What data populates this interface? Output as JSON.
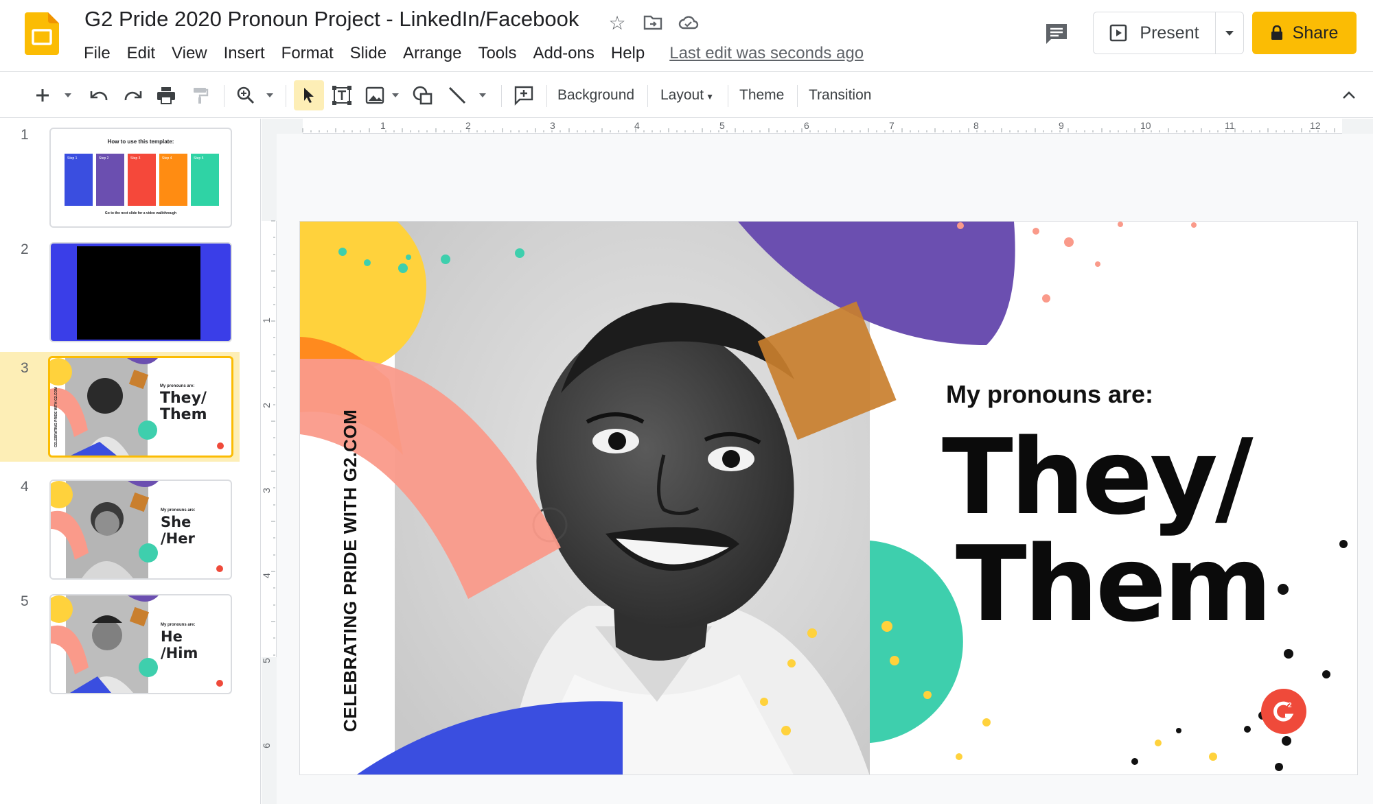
{
  "app": {
    "title": "G2 Pride 2020 Pronoun Project - LinkedIn/Facebook",
    "menu": [
      "File",
      "Edit",
      "View",
      "Insert",
      "Format",
      "Slide",
      "Arrange",
      "Tools",
      "Add-ons",
      "Help"
    ],
    "last_edit": "Last edit was seconds ago",
    "present_label": "Present",
    "share_label": "Share"
  },
  "toolbar": {
    "background_label": "Background",
    "layout_label": "Layout",
    "theme_label": "Theme",
    "transition_label": "Transition"
  },
  "ruler": {
    "horizontal": [
      "1",
      "2",
      "3",
      "4",
      "5",
      "6",
      "7",
      "8",
      "9",
      "10",
      "11",
      "12"
    ],
    "vertical": [
      "1",
      "2",
      "3",
      "4",
      "5",
      "6"
    ]
  },
  "filmstrip": {
    "active_index": 3,
    "slides": [
      {
        "number": "1",
        "title": "How to use this template:",
        "steps": [
          "Step 1",
          "Step 2",
          "Step 3",
          "Step 4",
          "Step 5"
        ],
        "footer": "Go to the next slide for a video walkthrough"
      },
      {
        "number": "2"
      },
      {
        "number": "3",
        "label": "My pronouns are:",
        "line1": "They/",
        "line2": "Them"
      },
      {
        "number": "4",
        "label": "My pronouns are:",
        "line1": "She",
        "line2": "/Her"
      },
      {
        "number": "5",
        "label": "My pronouns are:",
        "line1": "He",
        "line2": "/Him"
      }
    ]
  },
  "slide": {
    "label": "My pronouns are:",
    "line1": "They/",
    "line2": "Them",
    "vertical_text": "CELEBRATING PRIDE WITH G2.COM"
  },
  "colors": {
    "accent_yellow": "#fbbc04",
    "active_slide_bg": "#fdeeb6",
    "purple": "#6b4fb0",
    "orange": "#ff8a1e",
    "coral": "#fa9a8a",
    "teal": "#3ecfad",
    "blue": "#3a4ee0",
    "brown": "#c97f2e",
    "g2_red": "#ef4a3a"
  }
}
